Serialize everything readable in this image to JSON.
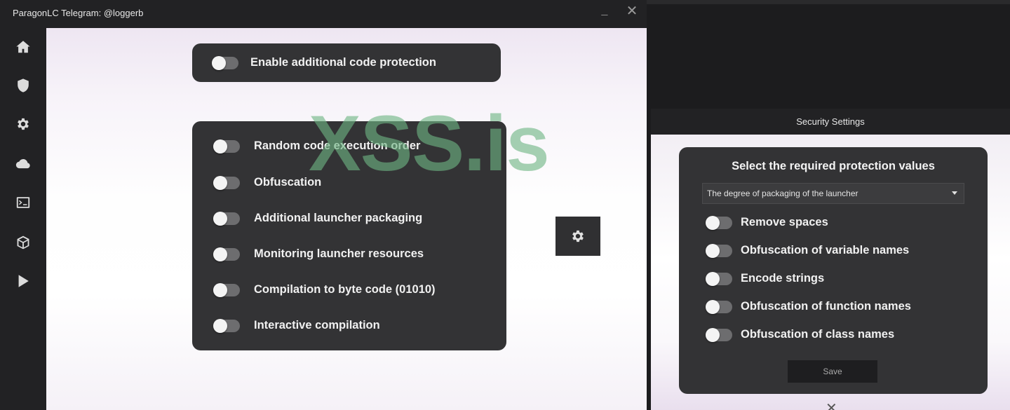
{
  "main_window": {
    "title": "ParagonLC Telegram: @loggerb",
    "controls": {
      "minimize": "_",
      "close": "✕"
    },
    "sidebar": {
      "items": [
        {
          "id": "home",
          "icon": "home-icon"
        },
        {
          "id": "security",
          "icon": "shield-icon"
        },
        {
          "id": "settings",
          "icon": "gear-icon"
        },
        {
          "id": "cloud",
          "icon": "cloud-icon"
        },
        {
          "id": "terminal",
          "icon": "terminal-icon"
        },
        {
          "id": "package",
          "icon": "cube-icon"
        },
        {
          "id": "run",
          "icon": "play-icon"
        }
      ]
    },
    "enable_protection": {
      "label": "Enable additional code protection",
      "enabled": false
    },
    "options": [
      {
        "label": "Random code execution order",
        "enabled": false
      },
      {
        "label": "Obfuscation",
        "enabled": false
      },
      {
        "label": "Additional launcher packaging",
        "enabled": false
      },
      {
        "label": "Monitoring launcher resources",
        "enabled": false
      },
      {
        "label": "Compilation to byte code (01010)",
        "enabled": false
      },
      {
        "label": "Interactive compilation",
        "enabled": false
      }
    ],
    "settings_button_icon": "gear-icon"
  },
  "watermark": "XSS.is",
  "security_window": {
    "title": "Security Settings",
    "heading": "Select the required protection values",
    "select": {
      "value": "The degree of packaging of the launcher"
    },
    "options": [
      {
        "label": "Remove spaces",
        "enabled": false
      },
      {
        "label": "Obfuscation of variable names",
        "enabled": false
      },
      {
        "label": "Encode strings",
        "enabled": false
      },
      {
        "label": "Obfuscation of function names",
        "enabled": false
      },
      {
        "label": "Obfuscation of class names",
        "enabled": false
      }
    ],
    "save_label": "Save",
    "close": "✕"
  },
  "colors": {
    "card": "#333335",
    "toggle_track": "#6d6d6f",
    "toggle_knob": "#f4f4f4",
    "watermark": "#6eb482",
    "window": "#222224"
  }
}
